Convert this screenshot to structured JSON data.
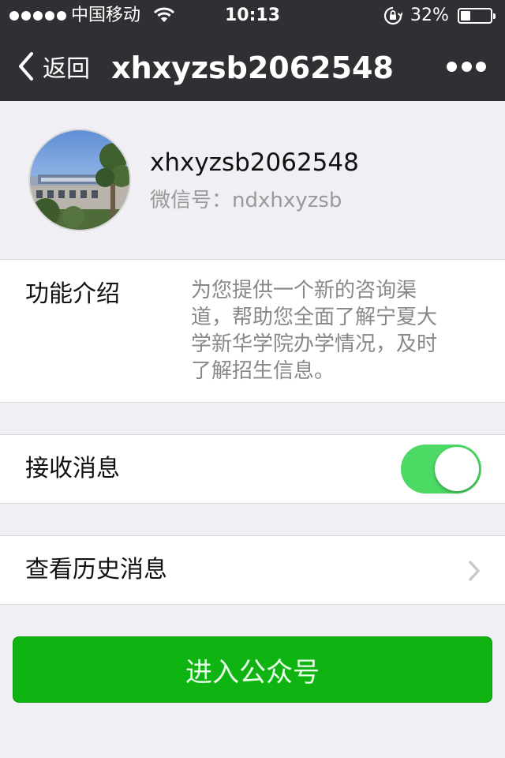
{
  "status_bar": {
    "carrier": "中国移动",
    "time": "10:13",
    "battery_percent": "32%",
    "battery_level": 0.32,
    "icons": [
      "signal-dots-icon",
      "wifi-icon",
      "rotation-lock-icon",
      "battery-icon"
    ]
  },
  "nav": {
    "back_label": "返回",
    "title": "xhxyzsb2062548",
    "back_icon": "chevron-left-icon",
    "more_icon": "more-dots-icon"
  },
  "profile": {
    "name": "xhxyzsb2062548",
    "wechat_id_label": "微信号：",
    "wechat_id": "ndxhxyzsb",
    "avatar": "avatar-campus-building"
  },
  "intro": {
    "label": "功能介绍",
    "lines": [
      "为您提供一个新的咨询渠",
      "道，帮助您全面了解宁夏大",
      "学新华学院办学情况，及时",
      "了解招生信息。"
    ]
  },
  "receive_messages": {
    "label": "接收消息",
    "enabled": true
  },
  "history": {
    "label": "查看历史消息",
    "arrow_icon": "chevron-right-icon"
  },
  "enter_button": {
    "label": "进入公众号"
  },
  "colors": {
    "nav_bg": "#2f3033",
    "page_bg": "#efeff4",
    "toggle_on": "#4cd964",
    "primary_button": "#0fb412"
  }
}
